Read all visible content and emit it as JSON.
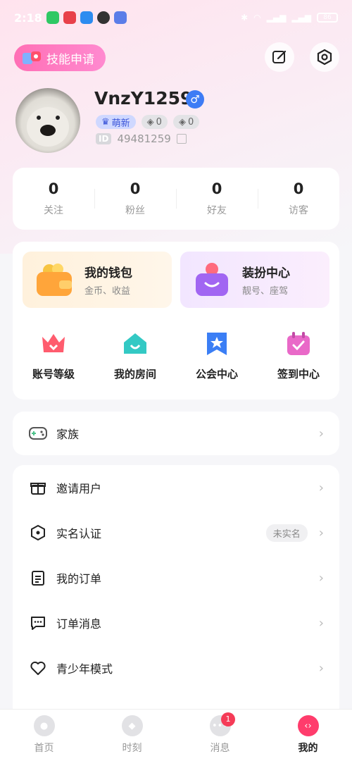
{
  "status_bar": {
    "time": "2:18",
    "battery": "86"
  },
  "header": {
    "skill_button_label": "技能申请"
  },
  "profile": {
    "username": "VnzY1259",
    "gender_symbol": "♂",
    "badge_new": "萌新",
    "badge_level_1": "0",
    "badge_level_2": "0",
    "id_tag": "ID",
    "id_value": "49481259"
  },
  "stats": [
    {
      "value": "0",
      "label": "关注"
    },
    {
      "value": "0",
      "label": "粉丝"
    },
    {
      "value": "0",
      "label": "好友"
    },
    {
      "value": "0",
      "label": "访客"
    }
  ],
  "features": {
    "wallet": {
      "title": "我的钱包",
      "subtitle": "金币、收益"
    },
    "dress": {
      "title": "装扮中心",
      "subtitle": "靓号、座驾"
    },
    "quick": [
      {
        "label": "账号等级",
        "color": "#ff5c6e"
      },
      {
        "label": "我的房间",
        "color": "#33c9c4"
      },
      {
        "label": "公会中心",
        "color": "#3b7ef5"
      },
      {
        "label": "签到中心",
        "color": "#e969c8"
      }
    ]
  },
  "family": {
    "label": "家族"
  },
  "menu": [
    {
      "label": "邀请用户",
      "icon": "gift-icon"
    },
    {
      "label": "实名认证",
      "icon": "shield-icon",
      "pill": "未实名"
    },
    {
      "label": "我的订单",
      "icon": "clipboard-icon"
    },
    {
      "label": "订单消息",
      "icon": "chat-icon"
    },
    {
      "label": "青少年模式",
      "icon": "heart-icon"
    }
  ],
  "bottom_nav": [
    {
      "label": "首页"
    },
    {
      "label": "时刻"
    },
    {
      "label": "消息",
      "badge": "1"
    },
    {
      "label": "我的"
    }
  ]
}
